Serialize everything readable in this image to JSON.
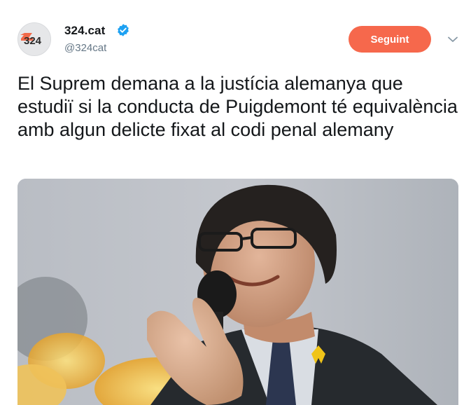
{
  "tweet": {
    "author": {
      "display_name": "324.cat",
      "handle": "@324cat",
      "verified": true,
      "avatar_logo_text": "324",
      "verified_icon": "verified-badge-icon"
    },
    "follow_button_label": "Seguint",
    "more_menu_icon": "chevron-down-icon",
    "text": "El Suprem demana a la justícia alemanya que estudiï si la conducta de Puigdemont té equivalència amb algun delicte fixat al codi penal alemany"
  },
  "colors": {
    "follow_button": "#f6684c",
    "verified_blue": "#1da1f2",
    "text": "#14171a",
    "secondary_text": "#657786"
  }
}
